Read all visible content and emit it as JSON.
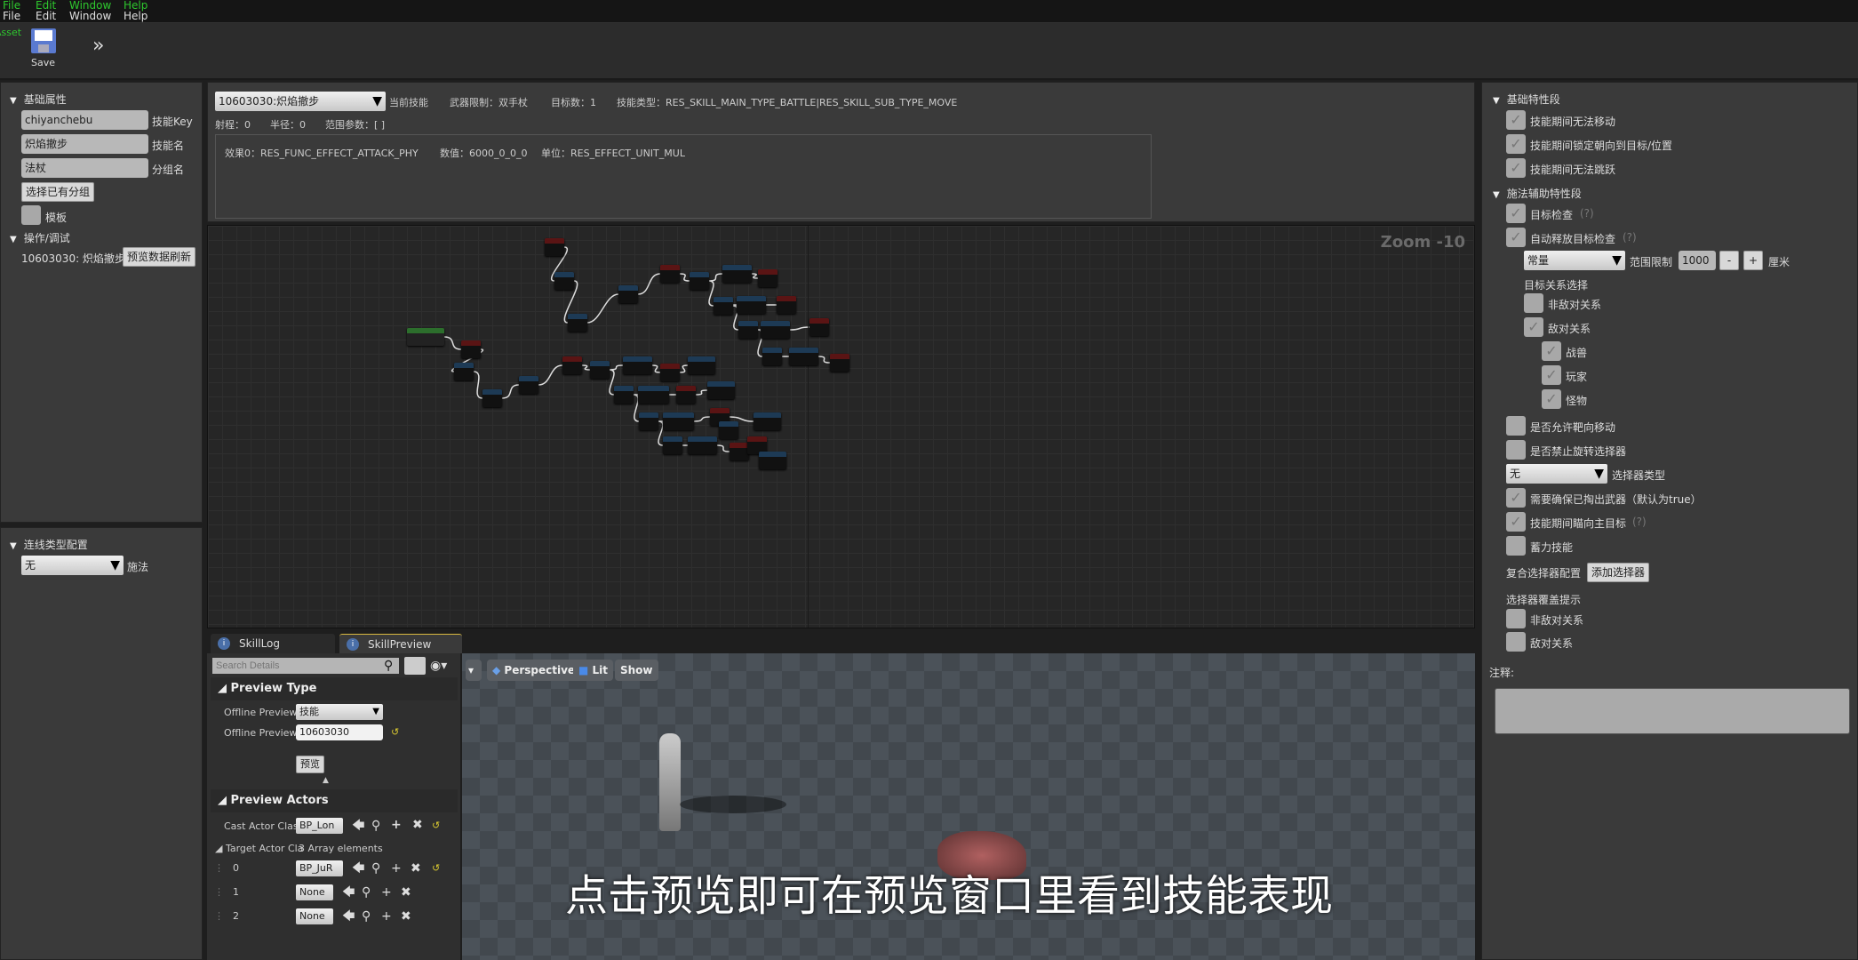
{
  "menu": {
    "ghost": [
      "File",
      "Edit",
      "Window",
      "Help"
    ],
    "items": [
      "File",
      "Edit",
      "Window",
      "Help"
    ]
  },
  "toolbar": {
    "asset_label": "Asset",
    "save_label": "Save",
    "more_icon": "chevron-double-right-icon"
  },
  "left_panel": {
    "basic_header": "基础属性",
    "skill_key_value": "chiyanchebu",
    "skill_key_label": "技能Key",
    "skill_name_value": "炽焰撤步",
    "skill_name_label": "技能名",
    "group_value": "法杖",
    "group_label": "分组名",
    "choose_group_button": "选择已有分组",
    "template_label": "模板",
    "template_checked": false,
    "ops_header": "操作/调试",
    "ops_skill": "10603030: 炽焰撤步",
    "refresh_button": "预览数据刷新"
  },
  "link_panel": {
    "header": "连线类型配置",
    "select_value": "无",
    "select_label": "施法"
  },
  "skill_info": {
    "skill_select": "10603030:炽焰撤步",
    "current_skill": "当前技能",
    "weapon": "武器限制：双手杖",
    "targets": "目标数：1",
    "type": "技能类型：RES_SKILL_MAIN_TYPE_BATTLE|RES_SKILL_SUB_TYPE_MOVE",
    "range": "射程：0",
    "radius": "半径：0",
    "range_params": "范围参数：[ ]",
    "effect": "效果0：RES_FUNC_EFFECT_ATTACK_PHY",
    "value": "数值：6000_0_0_0",
    "unit": "单位：RES_EFFECT_UNIT_MUL"
  },
  "graph": {
    "zoom": "Zoom -10"
  },
  "tabs": [
    {
      "label": "SkillLog",
      "active": false
    },
    {
      "label": "SkillPreview",
      "active": true
    }
  ],
  "details": {
    "search_placeholder": "Search Details",
    "preview_type_header": "Preview Type",
    "offline_type_label": "Offline Preview T",
    "offline_type_value": "技能",
    "offline_id_label": "Offline Preview I",
    "offline_id_value": "10603030",
    "preview_button": "预览",
    "actors_header": "Preview Actors",
    "cast_label": "Cast Actor Class",
    "cast_value": "BP_Lon",
    "target_label": "Target Actor Cla",
    "target_count": "3 Array elements",
    "targets": [
      {
        "index": "0",
        "value": "BP_JuR"
      },
      {
        "index": "1",
        "value": "None"
      },
      {
        "index": "2",
        "value": "None"
      }
    ]
  },
  "viewport": {
    "perspective": "Perspective",
    "lit": "Lit",
    "show": "Show",
    "subtitle": "点击预览即可在预览窗口里看到技能表现"
  },
  "right_panel": {
    "basic_header": "基础特性段",
    "basic": [
      {
        "label": "技能期间无法移动",
        "checked": true
      },
      {
        "label": "技能期间锁定朝向到目标/位置",
        "checked": true
      },
      {
        "label": "技能期间无法跳跃",
        "checked": true
      }
    ],
    "cast_header": "施法辅助特性段",
    "target_check": "目标检查",
    "target_check_hint": "(?)",
    "auto_check": "自动释放目标检查",
    "auto_check_hint": "(?)",
    "range_select": "常量",
    "range_label": "范围限制",
    "range_value": "1000",
    "minus": "-",
    "plus": "+",
    "range_unit": "厘米",
    "relation_header": "目标关系选择",
    "non_hostile": "非敌对关系",
    "hostile": "敌对关系",
    "hostile_sub": [
      "战兽",
      "玩家",
      "怪物"
    ],
    "allow_move": "是否允许靶向移动",
    "forbid_rotate": "是否禁止旋转选择器",
    "selector_type_value": "无",
    "selector_type_label": "选择器类型",
    "need_weapon": "需要确保已掏出武器（默认为true）",
    "face_target": "技能期间瞄向主目标",
    "face_target_hint": "(?)",
    "charge": "蓄力技能",
    "composite_label": "复合选择器配置",
    "add_selector": "添加选择器",
    "override_header": "选择器覆盖提示",
    "override_non_hostile": "非敌对关系",
    "override_hostile": "敌对关系",
    "note_label": "注释:"
  },
  "colors": {
    "accent_green": "#2ec82e",
    "node_blue": "#1d3a55",
    "node_red": "#5a1414",
    "panel": "#3a3a3a"
  }
}
